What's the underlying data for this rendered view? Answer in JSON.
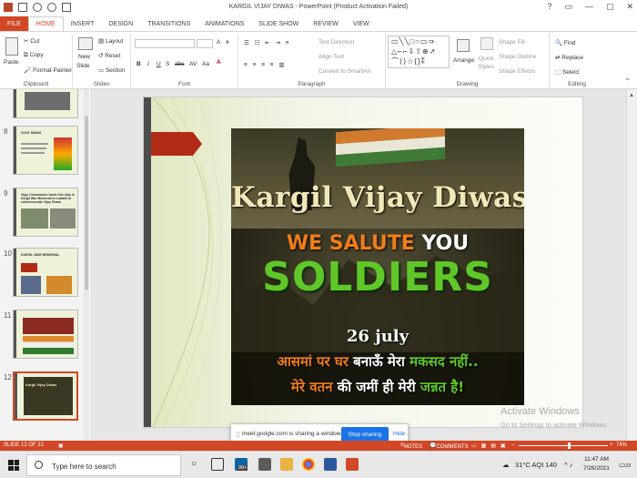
{
  "window": {
    "title": "KARGIL VIJAY DIWAS - PowerPoint (Product Activation Failed)",
    "controls": [
      "?",
      "▭",
      "—",
      "▢",
      "✕"
    ]
  },
  "tabs": [
    "FILE",
    "HOME",
    "INSERT",
    "DESIGN",
    "TRANSITIONS",
    "ANIMATIONS",
    "SLIDE SHOW",
    "REVIEW",
    "VIEW"
  ],
  "ribbon": {
    "clipboard": {
      "label": "Clipboard",
      "paste": "Paste",
      "cut": "Cut",
      "copy": "Copy",
      "format_painter": "Format Painter"
    },
    "slides": {
      "label": "Slides",
      "new_slide": "New",
      "new_slide2": "Slide",
      "layout": "Layout",
      "reset": "Reset",
      "section": "Section"
    },
    "font": {
      "label": "Font",
      "bold": "B",
      "italic": "I",
      "underline": "U",
      "shadow": "S",
      "strike": "abc",
      "spacing": "AV",
      "case": "Aa",
      "grow": "A",
      "shrink": "A"
    },
    "paragraph": {
      "label": "Paragraph",
      "text_direction": "Text Direction",
      "align_text": "Align Text",
      "smartart": "Convert to SmartArt"
    },
    "drawing": {
      "label": "Drawing",
      "arrange": "Arrange",
      "quick_styles": "Quick",
      "quick_styles2": "Styles",
      "shape_fill": "Shape Fill",
      "shape_outline": "Shape Outline",
      "shape_effects": "Shape Effects"
    },
    "editing": {
      "label": "Editing",
      "find": "Find",
      "replace": "Replace",
      "select": "Select"
    }
  },
  "thumbnails": [
    {
      "num": "8",
      "heading": "VIJAY DIWAS"
    },
    {
      "num": "9",
      "heading": "Vijay Commander leads this rally in Kargil War Memorial in Ladakh to commemorate Vijay Diwas"
    },
    {
      "num": "10",
      "heading": "KARGIL WAR MEMORIAL"
    },
    {
      "num": "11",
      "heading": ""
    },
    {
      "num": "12",
      "heading": "Kargil Vijay Diwas"
    }
  ],
  "slide": {
    "title": "Kargil Vijay Diwas",
    "salute_a": "WE SALUTE",
    "salute_b": "YOU",
    "soldiers": "SOLDIERS",
    "date": "26 july",
    "hindi1_a": "आसमां पर घर ",
    "hindi1_b": "बनाऊँ मेरा ",
    "hindi1_c": "मकसद नहीं..",
    "hindi2_a": "मेरे वतन ",
    "hindi2_b": "की जमीं ही मेरी ",
    "hindi2_c": "जन्नत है!"
  },
  "watermark": {
    "line1": "Activate Windows",
    "line2": "Go to Settings to activate Windows."
  },
  "sharebar": {
    "grip": "⁞⁞",
    "message": "meet.google.com is sharing a window.",
    "stop": "Stop sharing",
    "hide": "Hide"
  },
  "status": {
    "slide": "SLIDE 12 OF 12",
    "notes": "NOTES",
    "comments": "COMMENTS",
    "zoom": "74%"
  },
  "taskbar": {
    "search_placeholder": "Type here to search",
    "temperature": "31°C  AQI 140",
    "time": "11:47 AM",
    "date": "7/26/2021",
    "notification_count": "23",
    "badge": "99+"
  }
}
